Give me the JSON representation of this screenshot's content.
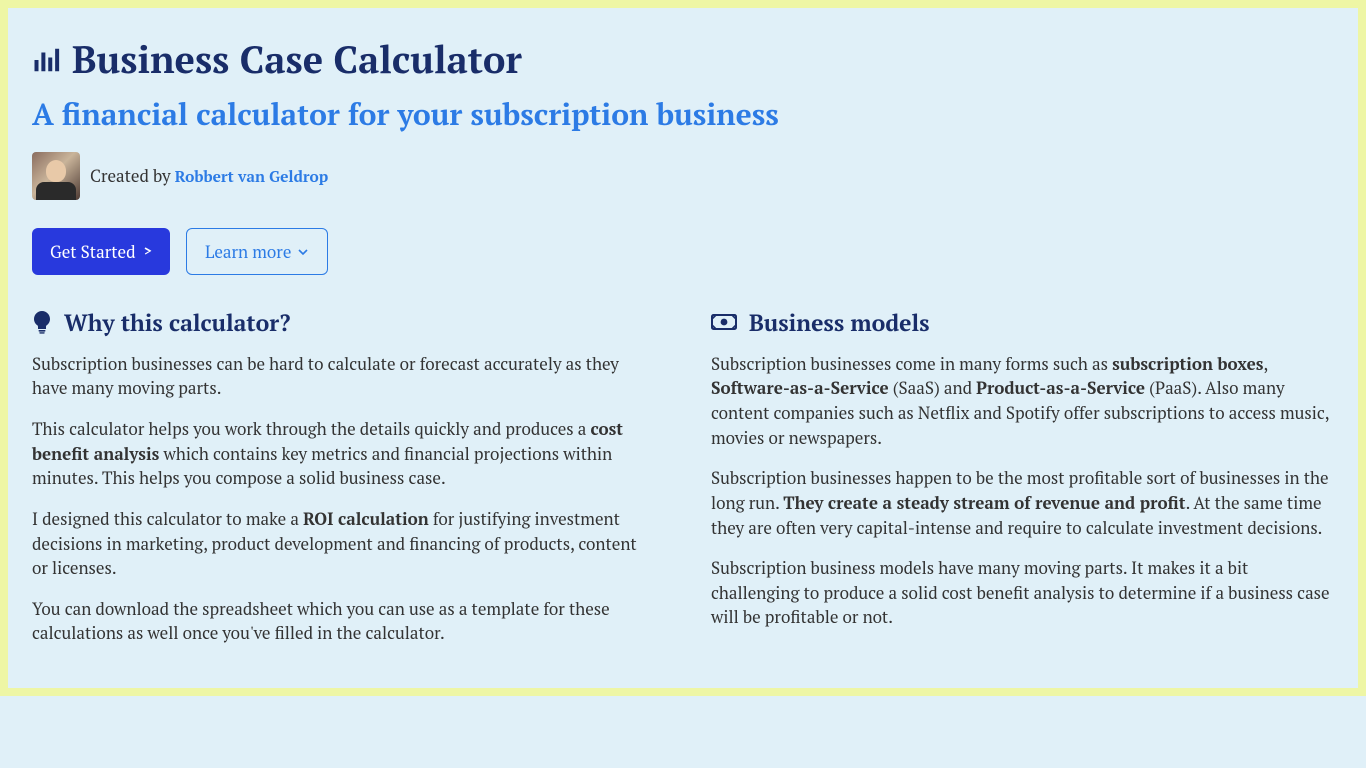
{
  "header": {
    "title": "Business Case Calculator",
    "subtitle": "A financial calculator for your subscription business"
  },
  "byline": {
    "prefix": "Created by ",
    "author": "Robbert van Geldrop"
  },
  "actions": {
    "get_started": "Get Started",
    "learn_more": "Learn more"
  },
  "sections": {
    "why": {
      "heading": "Why this calculator?",
      "p1": "Subscription businesses can be hard to calculate or forecast accurately as they have many moving parts.",
      "p2_a": "This calculator helps you work through the details quickly and produces a ",
      "p2_b": "cost benefit analysis",
      "p2_c": " which contains key metrics and financial projections within minutes. This helps you compose a solid business case.",
      "p3_a": "I designed this calculator to make a ",
      "p3_b": "ROI calculation",
      "p3_c": " for justifying investment decisions in marketing, product development and financing of products, content or licenses.",
      "p4": "You can download the spreadsheet which you can use as a template for these calculations as well once you've filled in the calculator."
    },
    "models": {
      "heading": "Business models",
      "p1_a": "Subscription businesses come in many forms such as ",
      "p1_b": "subscription boxes",
      "p1_c": ", ",
      "p1_d": "Software-as-a-Service",
      "p1_e": " (SaaS) and ",
      "p1_f": "Product-as-a-Service",
      "p1_g": " (PaaS). Also many content companies such as Netflix and Spotify offer subscriptions to access music, movies or newspapers.",
      "p2_a": "Subscription businesses happen to be the most profitable sort of businesses in the long run. ",
      "p2_b": "They create a steady stream of revenue and profit",
      "p2_c": ". At the same time they are often very capital-intense and require to calculate investment decisions.",
      "p3": "Subscription business models have many moving parts. It makes it a bit challenging to produce a solid cost benefit analysis to determine if a business case will be profitable or not."
    }
  }
}
